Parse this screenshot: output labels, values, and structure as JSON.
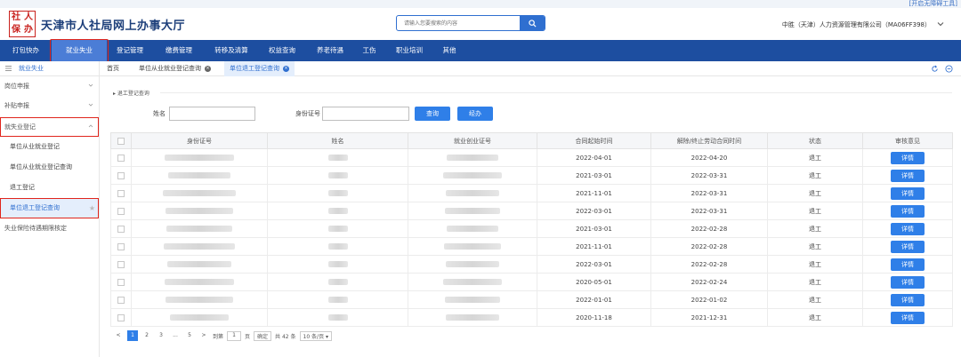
{
  "top_strip": {
    "accessibility": "[开启无障碍工具]"
  },
  "header": {
    "logo_chars": [
      "社",
      "人",
      "保",
      "办"
    ],
    "title": "天津市人社局网上办事大厅",
    "search_placeholder": "请输入您要搜索的内容",
    "user": "中胜（天津）人力资源管理有限公司（MA06FF398）"
  },
  "nav": [
    "打包快办",
    "就业失业",
    "登记管理",
    "缴费管理",
    "转移及清算",
    "权益查询",
    "养老待遇",
    "工伤",
    "职业培训",
    "其他"
  ],
  "sidebar": {
    "head": "就业失业",
    "groups": [
      "岗位申报",
      "补贴申报",
      "就失业登记"
    ],
    "subs": [
      "单位从业就业登记",
      "单位从业就业登记查询",
      "退工登记",
      "单位退工登记查询"
    ],
    "bottom": "失业保险待遇期限核定"
  },
  "tabs": [
    "首页",
    "单位从业就业登记查询",
    "单位退工登记查询"
  ],
  "form": {
    "section": "退工登记查询",
    "name_label": "姓名",
    "id_label": "身份证号",
    "query_button": "查询",
    "reset_button": "经办"
  },
  "table": {
    "headers": [
      "身份证号",
      "姓名",
      "就业创业证号",
      "合同起始时间",
      "解除/终止劳动合同时间",
      "状态",
      "审核意见"
    ],
    "detail_label": "详情",
    "rows": [
      {
        "start": "2022-04-01",
        "end": "2022-04-20",
        "status": "退工"
      },
      {
        "start": "2021-03-01",
        "end": "2022-03-31",
        "status": "退工"
      },
      {
        "start": "2021-11-01",
        "end": "2022-03-31",
        "status": "退工"
      },
      {
        "start": "2022-03-01",
        "end": "2022-03-31",
        "status": "退工"
      },
      {
        "start": "2021-03-01",
        "end": "2022-02-28",
        "status": "退工"
      },
      {
        "start": "2021-11-01",
        "end": "2022-02-28",
        "status": "退工"
      },
      {
        "start": "2022-03-01",
        "end": "2022-02-28",
        "status": "退工"
      },
      {
        "start": "2020-05-01",
        "end": "2022-02-24",
        "status": "退工"
      },
      {
        "start": "2022-01-01",
        "end": "2022-01-02",
        "status": "退工"
      },
      {
        "start": "2020-11-18",
        "end": "2021-12-31",
        "status": "退工"
      }
    ]
  },
  "pagination": {
    "pages": [
      "1",
      "2",
      "3",
      "...",
      "5"
    ],
    "goto": "到第",
    "page_input": "1",
    "page_unit": "页",
    "confirm": "确定",
    "total": "共 42 条",
    "per_page": "10 条/页"
  },
  "colors": {
    "nav_bg": "#1d4ea0",
    "primary": "#2f7fe8",
    "highlight": "#e0251c"
  }
}
